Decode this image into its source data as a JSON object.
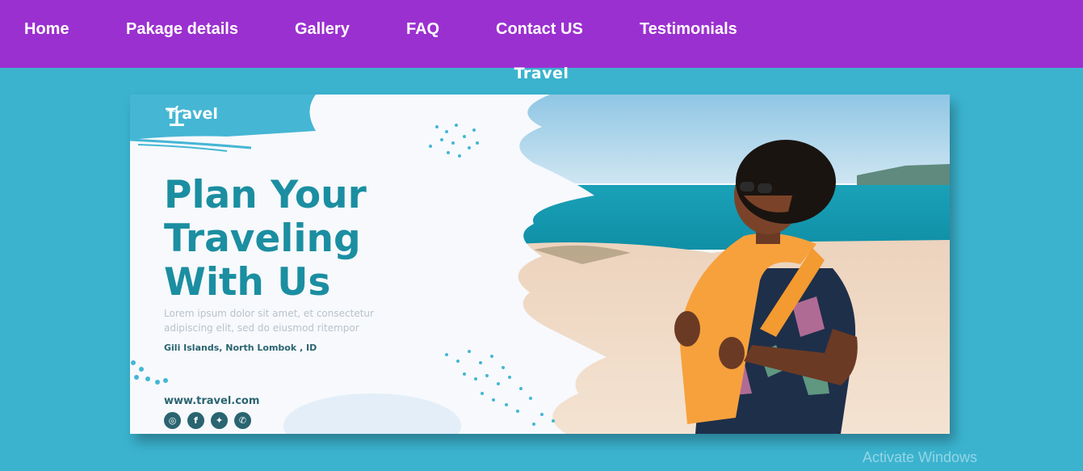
{
  "nav": {
    "items": [
      {
        "label": "Home"
      },
      {
        "label": "Pakage details"
      },
      {
        "label": "Gallery"
      },
      {
        "label": "FAQ"
      },
      {
        "label": "Contact US"
      },
      {
        "label": "Testimonials"
      }
    ]
  },
  "heading": "Travel",
  "banner": {
    "brand": "Travel",
    "headline": [
      "Plan Your",
      "Traveling",
      "With Us"
    ],
    "lorem": [
      "Lorem ipsum dolor sit amet, et consectetur",
      "adipiscing elit, sed do eiusmod ritempor"
    ],
    "location": "Gili Islands, North Lombok , ID",
    "website": "www.travel.com",
    "socials": [
      "instagram-icon",
      "facebook-icon",
      "twitter-icon",
      "whatsapp-icon"
    ]
  },
  "watermark": "Activate Windows",
  "colors": {
    "navbar": "#9b30d0",
    "page_background": "#3bb3cf",
    "headline": "#1b8ea1",
    "brand_accent": "#45b6d4",
    "towel": "#f7a13c"
  }
}
